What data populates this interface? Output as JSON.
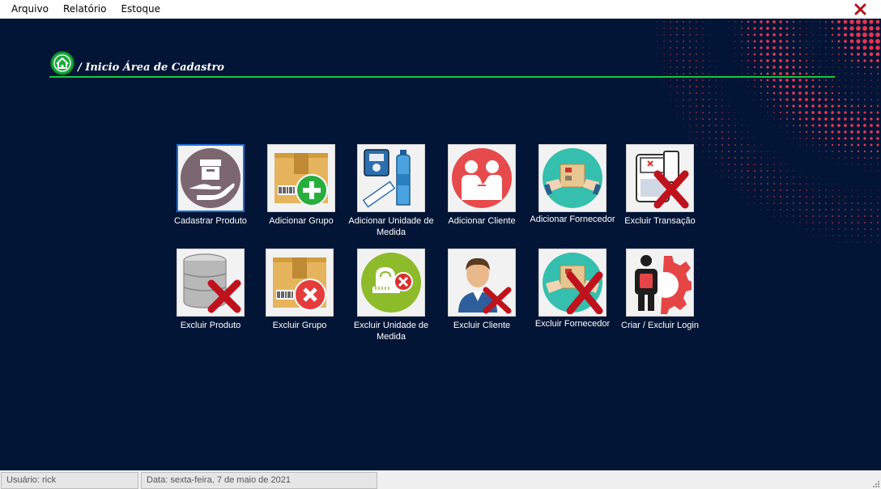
{
  "menu": {
    "items": [
      "Arquivo",
      "Relatório",
      "Estoque"
    ]
  },
  "window": {
    "close_icon": "close-x-icon"
  },
  "breadcrumb": {
    "text": "/ Inicio Área de Cadastro",
    "icon": "home-icon"
  },
  "tiles": {
    "cadastrar_produto": "Cadastrar Produto",
    "adicionar_grupo": "Adicionar Grupo",
    "adicionar_unidade": "Adicionar Unidade de Medida",
    "adicionar_cliente": "Adicionar Cliente",
    "adicionar_fornecedor": "Adicionar Fornecedor",
    "excluir_transacao": "Excluir Transação",
    "excluir_produto": "Excluir Produto",
    "excluir_grupo": "Excluir Grupo",
    "excluir_unidade": "Excluir Unidade de Medida",
    "excluir_cliente": "Excluir Cliente",
    "excluir_fornecedor": "Excluir Fornecedor",
    "criar_excluir_login": "Criar / Excluir Login"
  },
  "status": {
    "user": "Usuário: rick",
    "date": "Data: sexta-feira, 7 de maio de 2021"
  },
  "colors": {
    "background": "#031536",
    "accent_line": "#17c838",
    "dots": "#e8344e",
    "selected_border": "#1e6fd9"
  }
}
